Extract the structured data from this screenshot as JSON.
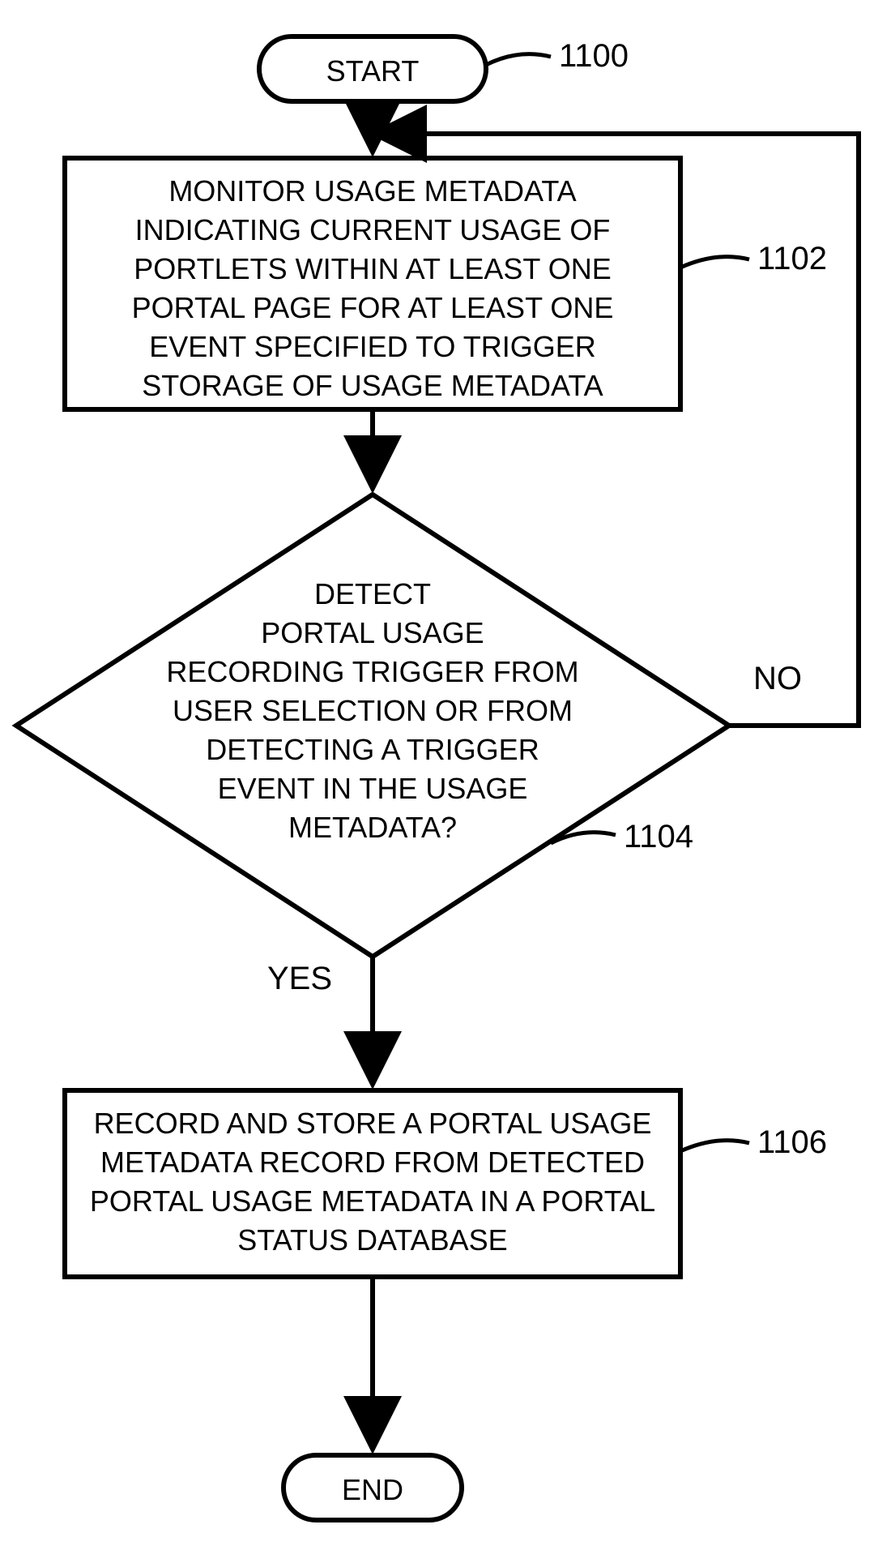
{
  "flowchart": {
    "start": {
      "label": "START",
      "ref": "1100"
    },
    "process1": {
      "lines": [
        "MONITOR USAGE METADATA",
        "INDICATING CURRENT USAGE OF",
        "PORTLETS WITHIN AT LEAST ONE",
        "PORTAL PAGE FOR AT LEAST ONE",
        "EVENT SPECIFIED TO TRIGGER",
        "STORAGE OF USAGE METADATA"
      ],
      "ref": "1102"
    },
    "decision": {
      "lines": [
        "DETECT",
        "PORTAL USAGE",
        "RECORDING TRIGGER FROM",
        "USER SELECTION OR FROM",
        "DETECTING A TRIGGER",
        "EVENT IN THE USAGE",
        "METADATA?"
      ],
      "ref": "1104",
      "no": "NO",
      "yes": "YES"
    },
    "process2": {
      "lines": [
        "RECORD AND STORE A PORTAL USAGE",
        "METADATA RECORD FROM DETECTED",
        "PORTAL USAGE METADATA IN A PORTAL",
        "STATUS DATABASE"
      ],
      "ref": "1106"
    },
    "end": {
      "label": "END"
    }
  }
}
